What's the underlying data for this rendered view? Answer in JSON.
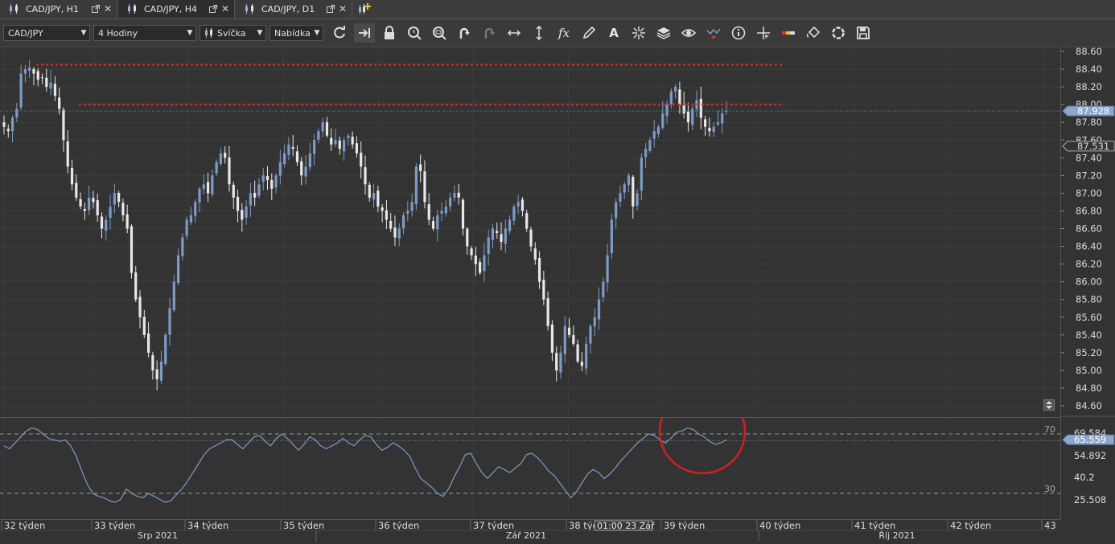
{
  "tabs": [
    {
      "label": "CAD/JPY, H1",
      "active": false
    },
    {
      "label": "CAD/JPY, H4",
      "active": true
    },
    {
      "label": "CAD/JPY, D1",
      "active": false
    }
  ],
  "toolbar": {
    "symbol": "CAD/JPY",
    "timeframe": "4 Hodiny",
    "chart_type": "Svíčka",
    "price_side": "Nabídka"
  },
  "tools": [
    "refresh-icon",
    "shift-right-icon",
    "lock-icon",
    "zoom-time-icon",
    "zoom-fit-icon",
    "undo-icon",
    "redo-icon",
    "horizontal-arrows-icon",
    "vertical-arrows-icon",
    "fx-icon",
    "pencil-icon",
    "text-icon",
    "crosshair-icon",
    "layers-icon",
    "eye-icon",
    "alert-icon",
    "info-icon",
    "cursor-icon",
    "ruler-icon",
    "fill-icon",
    "loading-icon",
    "save-icon"
  ],
  "price_axis": {
    "ticks": [
      "88.60",
      "88.40",
      "88.20",
      "88.00",
      "87.80",
      "87.60",
      "87.40",
      "87.20",
      "87.00",
      "86.80",
      "86.60",
      "86.40",
      "86.20",
      "86.00",
      "85.80",
      "85.60",
      "85.40",
      "85.20",
      "85.00",
      "84.80",
      "84.60"
    ],
    "current_price": "87.928",
    "marker_price": "87.531"
  },
  "rsi_axis": {
    "ticks": [
      "69.584",
      "54.892",
      "40.2",
      "25.508"
    ],
    "current_value": "65.559",
    "level_high": "70",
    "level_low": "30"
  },
  "time_axis": {
    "weeks": [
      "32 týden",
      "33 týden",
      "34 týden",
      "35 týden",
      "36 týden",
      "37 týden",
      "38 týd",
      "39 týden",
      "40 týden",
      "41 týden",
      "42 týden",
      "43"
    ],
    "months": [
      "Srp 2021",
      "Zář 2021",
      "Říj 2021"
    ],
    "cursor_label": "01:00 23 Zář"
  },
  "colors": {
    "background": "#333333",
    "bull_candle": "#7d9bc7",
    "bear_candle": "#e8e8e8",
    "resistance_line": "#cc2a2a",
    "rsi_line": "#7d9bc7",
    "highlight_circle": "#d42020",
    "price_label": "#8da6cc"
  },
  "chart_data": {
    "type": "candlestick",
    "symbol": "CAD/JPY",
    "timeframe": "4 Hodiny",
    "ylim": [
      84.55,
      88.65
    ],
    "resistance_levels": [
      88.45,
      88.0
    ],
    "close_path": [
      87.75,
      87.7,
      87.85,
      87.95,
      88.35,
      88.4,
      88.42,
      88.35,
      88.28,
      88.3,
      88.2,
      88.25,
      88.1,
      87.95,
      87.6,
      87.3,
      87.1,
      86.95,
      86.85,
      86.8,
      86.95,
      86.9,
      86.75,
      86.6,
      86.7,
      86.85,
      87.0,
      86.9,
      86.75,
      86.6,
      86.1,
      85.8,
      85.6,
      85.4,
      85.2,
      85.0,
      84.9,
      85.1,
      85.4,
      85.7,
      86.0,
      86.3,
      86.5,
      86.7,
      86.75,
      86.9,
      87.05,
      87.1,
      87.0,
      87.2,
      87.35,
      87.45,
      87.4,
      87.1,
      86.95,
      86.8,
      86.7,
      86.85,
      87.0,
      86.95,
      87.1,
      87.2,
      87.15,
      87.05,
      87.2,
      87.35,
      87.45,
      87.55,
      87.5,
      87.35,
      87.2,
      87.3,
      87.45,
      87.6,
      87.7,
      87.8,
      87.65,
      87.55,
      87.6,
      87.5,
      87.6,
      87.65,
      87.55,
      87.45,
      87.3,
      87.1,
      86.95,
      87.0,
      86.85,
      86.8,
      86.7,
      86.6,
      86.5,
      86.6,
      86.75,
      86.8,
      86.9,
      87.3,
      87.25,
      86.9,
      86.7,
      86.6,
      86.75,
      86.8,
      86.85,
      86.95,
      87.0,
      86.95,
      86.6,
      86.4,
      86.3,
      86.2,
      86.1,
      86.3,
      86.5,
      86.6,
      86.55,
      86.45,
      86.6,
      86.7,
      86.85,
      86.9,
      86.8,
      86.6,
      86.4,
      86.25,
      86.0,
      85.8,
      85.5,
      85.2,
      85.0,
      85.2,
      85.5,
      85.4,
      85.3,
      85.1,
      85.05,
      85.3,
      85.5,
      85.6,
      85.8,
      86.0,
      86.3,
      86.7,
      86.9,
      87.0,
      87.1,
      87.2,
      86.85,
      87.0,
      87.4,
      87.5,
      87.6,
      87.7,
      87.75,
      87.9,
      88.0,
      88.15,
      88.2,
      88.0,
      87.9,
      87.8,
      87.95,
      88.05,
      87.85,
      87.75,
      87.7,
      87.75,
      87.8,
      87.9,
      87.93
    ],
    "rsi_path": [
      62,
      60,
      64,
      68,
      72,
      74,
      73,
      70,
      67,
      66,
      65,
      66,
      62,
      55,
      45,
      36,
      30,
      28,
      27,
      25,
      24,
      26,
      33,
      30,
      28,
      27,
      30,
      28,
      26,
      24,
      25,
      29,
      33,
      38,
      44,
      50,
      56,
      60,
      62,
      64,
      66,
      66,
      63,
      60,
      64,
      68,
      69,
      65,
      62,
      67,
      70,
      67,
      63,
      59,
      63,
      68,
      66,
      62,
      60,
      62,
      64,
      67,
      64,
      62,
      66,
      69,
      68,
      63,
      59,
      61,
      64,
      62,
      59,
      55,
      47,
      40,
      37,
      34,
      30,
      28,
      33,
      41,
      48,
      56,
      57,
      50,
      44,
      40,
      44,
      48,
      46,
      44,
      47,
      50,
      56,
      57,
      54,
      50,
      45,
      42,
      37,
      32,
      27,
      31,
      37,
      43,
      46,
      44,
      40,
      43,
      47,
      52,
      56,
      60,
      64,
      67,
      70,
      69,
      66,
      64,
      67,
      71,
      72,
      74,
      73,
      70,
      68,
      65,
      63,
      64,
      66
    ],
    "rsi_levels": [
      70,
      30
    ]
  }
}
